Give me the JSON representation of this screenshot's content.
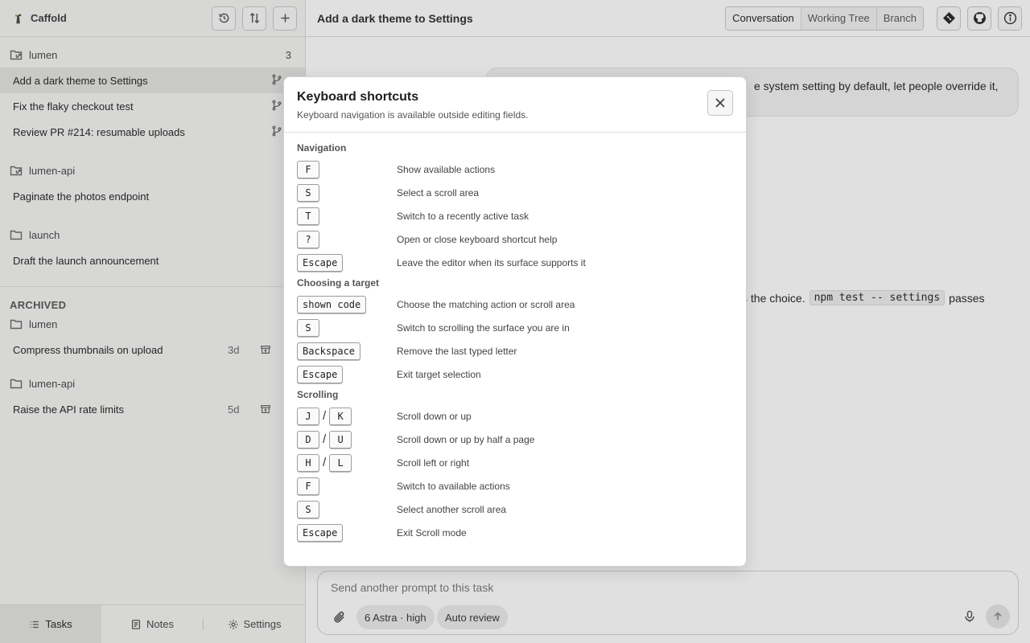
{
  "app": {
    "title": "Caffold"
  },
  "sidebar": {
    "groups": [
      {
        "name": "lumen",
        "count": "3",
        "tasks": [
          {
            "label": "Add a dark theme to Settings",
            "active": true
          },
          {
            "label": "Fix the flaky checkout test"
          },
          {
            "label": "Review PR #214: resumable uploads"
          }
        ]
      },
      {
        "name": "lumen-api",
        "count": "",
        "tasks": [
          {
            "label": "Paginate the photos endpoint"
          }
        ]
      },
      {
        "name": "launch",
        "count": "",
        "tasks": [
          {
            "label": "Draft the launch announcement"
          }
        ]
      }
    ],
    "archived_label": "ARCHIVED",
    "archived": [
      {
        "group": "lumen",
        "task": "Compress thumbnails on upload",
        "age": "3d"
      },
      {
        "group": "lumen-api",
        "task": "Raise the API rate limits",
        "age": "5d"
      }
    ],
    "tabs": {
      "tasks": "Tasks",
      "notes": "Notes",
      "settings": "Settings"
    }
  },
  "main": {
    "title": "Add a dark theme to Settings",
    "segments": {
      "conversation": "Conversation",
      "working_tree": "Working Tree",
      "branch": "Branch"
    },
    "bubble_line1": "e system setting by default, let people override it,",
    "assistant_fragment_before": "s the choice.",
    "assistant_code": "npm test -- settings",
    "assistant_fragment_after": "passes",
    "composer": {
      "placeholder": "Send another prompt to this task",
      "model": "6 Astra · high",
      "auto_review": "Auto review"
    }
  },
  "modal": {
    "title": "Keyboard shortcuts",
    "subtitle": "Keyboard navigation is available outside editing fields.",
    "sections": [
      {
        "title": "Navigation",
        "rows": [
          {
            "keys": [
              "F"
            ],
            "desc": "Show available actions"
          },
          {
            "keys": [
              "S"
            ],
            "desc": "Select a scroll area"
          },
          {
            "keys": [
              "T"
            ],
            "desc": "Switch to a recently active task"
          },
          {
            "keys": [
              "?"
            ],
            "desc": "Open or close keyboard shortcut help"
          },
          {
            "keys": [
              "Escape"
            ],
            "desc": "Leave the editor when its surface supports it"
          }
        ]
      },
      {
        "title": "Choosing a target",
        "rows": [
          {
            "keys": [
              "shown code"
            ],
            "desc": "Choose the matching action or scroll area"
          },
          {
            "keys": [
              "S"
            ],
            "desc": "Switch to scrolling the surface you are in"
          },
          {
            "keys": [
              "Backspace"
            ],
            "desc": "Remove the last typed letter"
          },
          {
            "keys": [
              "Escape"
            ],
            "desc": "Exit target selection"
          }
        ]
      },
      {
        "title": "Scrolling",
        "rows": [
          {
            "keys": [
              "J",
              "K"
            ],
            "desc": "Scroll down or up"
          },
          {
            "keys": [
              "D",
              "U"
            ],
            "desc": "Scroll down or up by half a page"
          },
          {
            "keys": [
              "H",
              "L"
            ],
            "desc": "Scroll left or right"
          },
          {
            "keys": [
              "F"
            ],
            "desc": "Switch to available actions"
          },
          {
            "keys": [
              "S"
            ],
            "desc": "Select another scroll area"
          },
          {
            "keys": [
              "Escape"
            ],
            "desc": "Exit Scroll mode"
          }
        ]
      }
    ]
  }
}
